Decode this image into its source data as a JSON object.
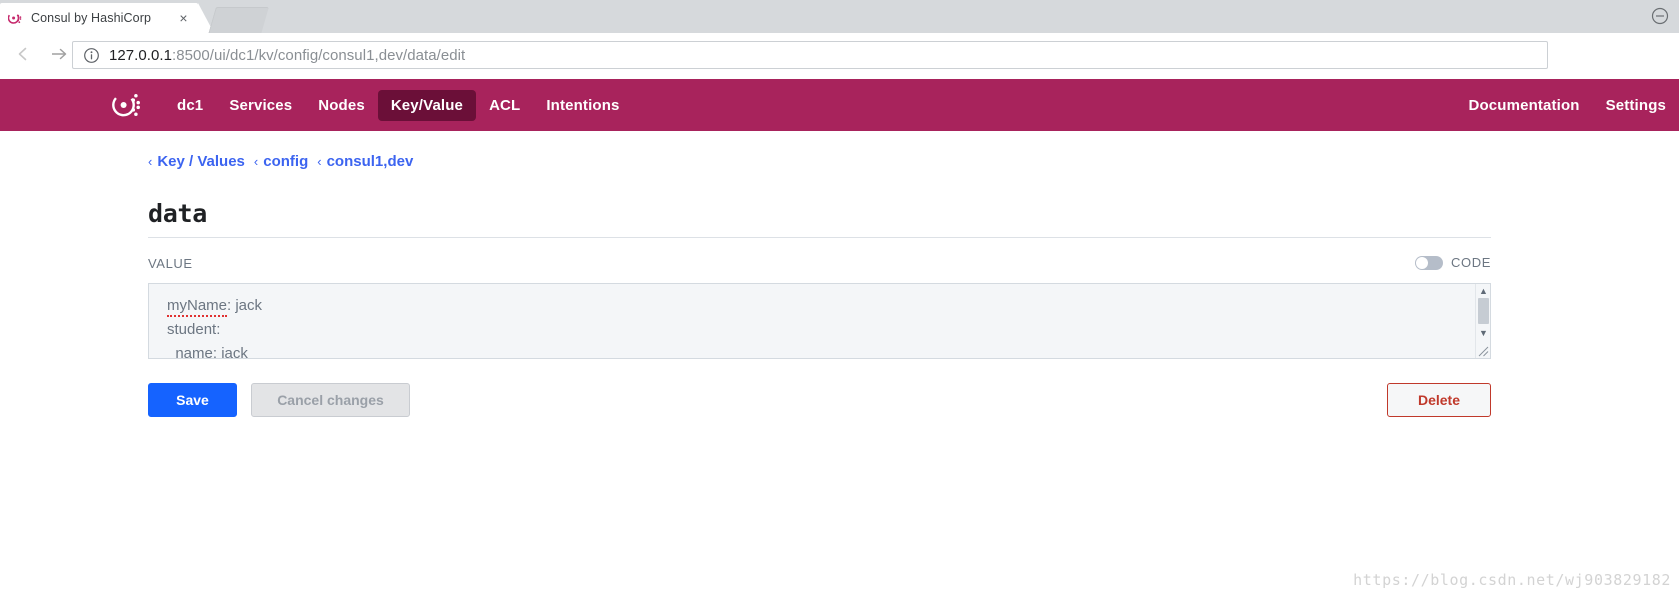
{
  "browser": {
    "tab": {
      "title": "Consul by HashiCorp",
      "favicon_name": "consul-favicon",
      "close_label": "×"
    },
    "toolbar": {
      "back_label": "←",
      "forward_label": "→",
      "reload_label": "↻",
      "url_host": "127.0.0.1",
      "url_rest": ":8500/ui/dc1/kv/config/consul1,dev/data/edit",
      "url_full": "127.0.0.1:8500/ui/dc1/kv/config/consul1,dev/data/edit",
      "site_info_icon": "info-circle-icon"
    },
    "window_controls": {
      "minimize_label": "⊖"
    }
  },
  "app_nav": {
    "brand_color": "#a8235c",
    "active_color": "#6b0f38",
    "logo_name": "consul-logo",
    "items": [
      {
        "label": "dc1",
        "active": false
      },
      {
        "label": "Services",
        "active": false
      },
      {
        "label": "Nodes",
        "active": false
      },
      {
        "label": "Key/Value",
        "active": true
      },
      {
        "label": "ACL",
        "active": false
      },
      {
        "label": "Intentions",
        "active": false
      }
    ],
    "right_items": [
      {
        "label": "Documentation"
      },
      {
        "label": "Settings"
      }
    ]
  },
  "breadcrumb": {
    "separator": "‹",
    "items": [
      {
        "label": "Key / Values"
      },
      {
        "label": "config"
      },
      {
        "label": "consul1,dev"
      }
    ],
    "link_color": "#3c64f0"
  },
  "page": {
    "title": "data"
  },
  "value_section": {
    "label": "VALUE",
    "code_toggle": {
      "label": "CODE",
      "state": "off"
    },
    "textarea": {
      "line1_spell": "myName",
      "line1_rest": ": jack",
      "line2": "student:",
      "line3": "  name: jack",
      "full_value": "myName: jack\nstudent:\n  name: jack"
    },
    "scrollbar": {
      "up_arrow": "▲",
      "down_arrow": "▼"
    }
  },
  "actions": {
    "save_label": "Save",
    "cancel_label": "Cancel changes",
    "delete_label": "Delete",
    "save_color": "#1563ff",
    "delete_color": "#c0392b"
  },
  "watermark": {
    "text": "https://blog.csdn.net/wj903829182"
  }
}
